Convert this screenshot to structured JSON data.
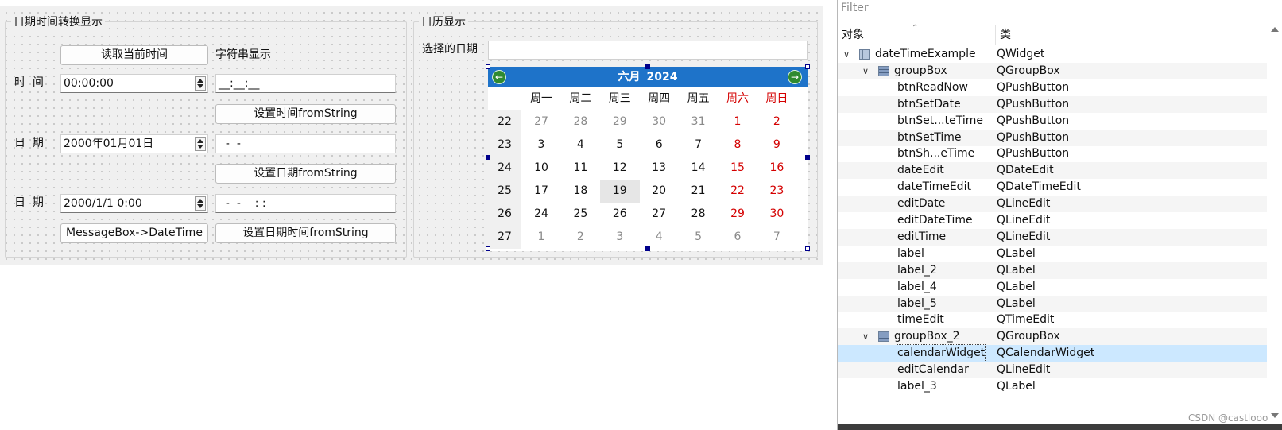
{
  "form": {
    "group1": {
      "title": "日期时间转换显示",
      "btn_read_now": "读取当前时间",
      "label_string_display": "字符串显示",
      "label_time": "时  间",
      "time_edit_value": "00:00:00",
      "edit_time_value": "__:__:__",
      "btn_set_time": "设置时间fromString",
      "label_date": "日  期",
      "date_edit_value": "2000年01月01日",
      "edit_date_value": "  -  -",
      "btn_set_date": "设置日期fromString",
      "label_datetime": "日  期",
      "datetime_edit_value": "2000/1/1 0:00",
      "edit_datetime_value": "  -  -    : :",
      "btn_show_datetime": "MessageBox->DateTime",
      "btn_set_datetime": "设置日期时间fromString"
    },
    "group2": {
      "title": "日历显示",
      "label_selected_date": "选择的日期",
      "edit_calendar_value": "",
      "calendar": {
        "month": "六月",
        "year": "2024",
        "prev_icon": "arrow-left-icon",
        "next_icon": "arrow-right-icon",
        "weekdays": [
          "周一",
          "周二",
          "周三",
          "周四",
          "周五",
          "周六",
          "周日"
        ],
        "weeks": [
          {
            "week": "22",
            "days": [
              "27",
              "28",
              "29",
              "30",
              "31",
              "1",
              "2"
            ]
          },
          {
            "week": "23",
            "days": [
              "3",
              "4",
              "5",
              "6",
              "7",
              "8",
              "9"
            ]
          },
          {
            "week": "24",
            "days": [
              "10",
              "11",
              "12",
              "13",
              "14",
              "15",
              "16"
            ]
          },
          {
            "week": "25",
            "days": [
              "17",
              "18",
              "19",
              "20",
              "21",
              "22",
              "23"
            ]
          },
          {
            "week": "26",
            "days": [
              "24",
              "25",
              "26",
              "27",
              "28",
              "29",
              "30"
            ]
          },
          {
            "week": "27",
            "days": [
              "1",
              "2",
              "3",
              "4",
              "5",
              "6",
              "7"
            ]
          }
        ],
        "selected_day": "19",
        "weekend_color": "#d40000",
        "header_color": "#1e73c9"
      }
    }
  },
  "inspector": {
    "filter_placeholder": "Filter",
    "col_object": "对象",
    "col_class": "类",
    "rows": [
      {
        "object": "dateTimeExample",
        "class": "QWidget"
      },
      {
        "object": "groupBox",
        "class": "QGroupBox"
      },
      {
        "object": "btnReadNow",
        "class": "QPushButton"
      },
      {
        "object": "btnSetDate",
        "class": "QPushButton"
      },
      {
        "object": "btnSet...teTime",
        "class": "QPushButton"
      },
      {
        "object": "btnSetTime",
        "class": "QPushButton"
      },
      {
        "object": "btnSh...eTime",
        "class": "QPushButton"
      },
      {
        "object": "dateEdit",
        "class": "QDateEdit"
      },
      {
        "object": "dateTimeEdit",
        "class": "QDateTimeEdit"
      },
      {
        "object": "editDate",
        "class": "QLineEdit"
      },
      {
        "object": "editDateTime",
        "class": "QLineEdit"
      },
      {
        "object": "editTime",
        "class": "QLineEdit"
      },
      {
        "object": "label",
        "class": "QLabel"
      },
      {
        "object": "label_2",
        "class": "QLabel"
      },
      {
        "object": "label_4",
        "class": "QLabel"
      },
      {
        "object": "label_5",
        "class": "QLabel"
      },
      {
        "object": "timeEdit",
        "class": "QTimeEdit"
      },
      {
        "object": "groupBox_2",
        "class": "QGroupBox"
      },
      {
        "object": "calendarWidget",
        "class": "QCalendarWidget"
      },
      {
        "object": "editCalendar",
        "class": "QLineEdit"
      },
      {
        "object": "label_3",
        "class": "QLabel"
      }
    ],
    "selected_row": "calendarWidget",
    "selection_color": "#cce8ff"
  },
  "watermark": "CSDN @castlooo"
}
